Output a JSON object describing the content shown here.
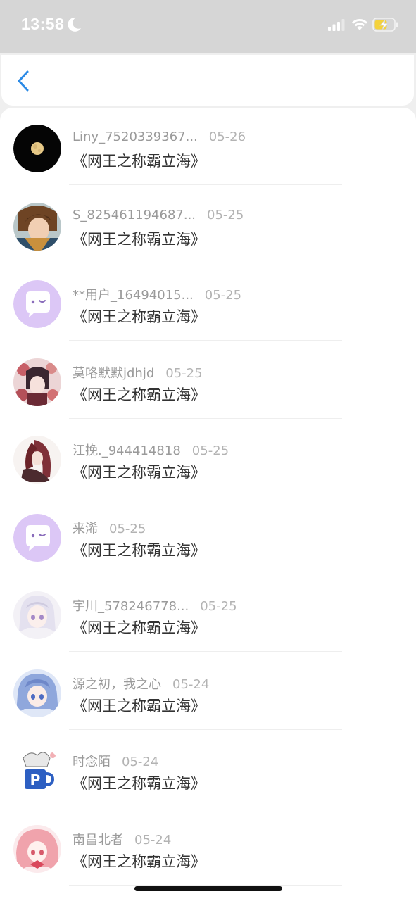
{
  "status_bar": {
    "time": "13:58"
  },
  "nav": {
    "back_icon": "chevron-left-icon",
    "accent": "#2b8ae6"
  },
  "items": [
    {
      "name": "Liny_7520339367...",
      "date": "05-26",
      "message": "《网王之称霸立海》",
      "avatar": "moon-avatar"
    },
    {
      "name": "S_825461194687...",
      "date": "05-25",
      "message": "《网王之称霸立海》",
      "avatar": "anime-boy-avatar"
    },
    {
      "name": "**用户_16494015...",
      "date": "05-25",
      "message": "《网王之称霸立海》",
      "avatar": "default-chat-avatar"
    },
    {
      "name": "莫咯默默jdhjd",
      "date": "05-25",
      "message": "《网王之称霸立海》",
      "avatar": "anime-flowers-avatar"
    },
    {
      "name": "江挽._944414818",
      "date": "05-25",
      "message": "《网王之称霸立海》",
      "avatar": "anime-red-hair-avatar"
    },
    {
      "name": "来浠",
      "date": "05-25",
      "message": "《网王之称霸立海》",
      "avatar": "default-chat-avatar"
    },
    {
      "name": "宇川_578246778...",
      "date": "05-25",
      "message": "《网王之称霸立海》",
      "avatar": "anime-white-hair-avatar"
    },
    {
      "name": "源之初，我之心",
      "date": "05-24",
      "message": "《网王之称霸立海》",
      "avatar": "anime-blue-hair-avatar"
    },
    {
      "name": "时念陌",
      "date": "05-24",
      "message": "《网王之称霸立海》",
      "avatar": "mug-character-avatar"
    },
    {
      "name": "南昌北者",
      "date": "05-24",
      "message": "《网王之称霸立海》",
      "avatar": "anime-pink-hair-avatar"
    }
  ]
}
